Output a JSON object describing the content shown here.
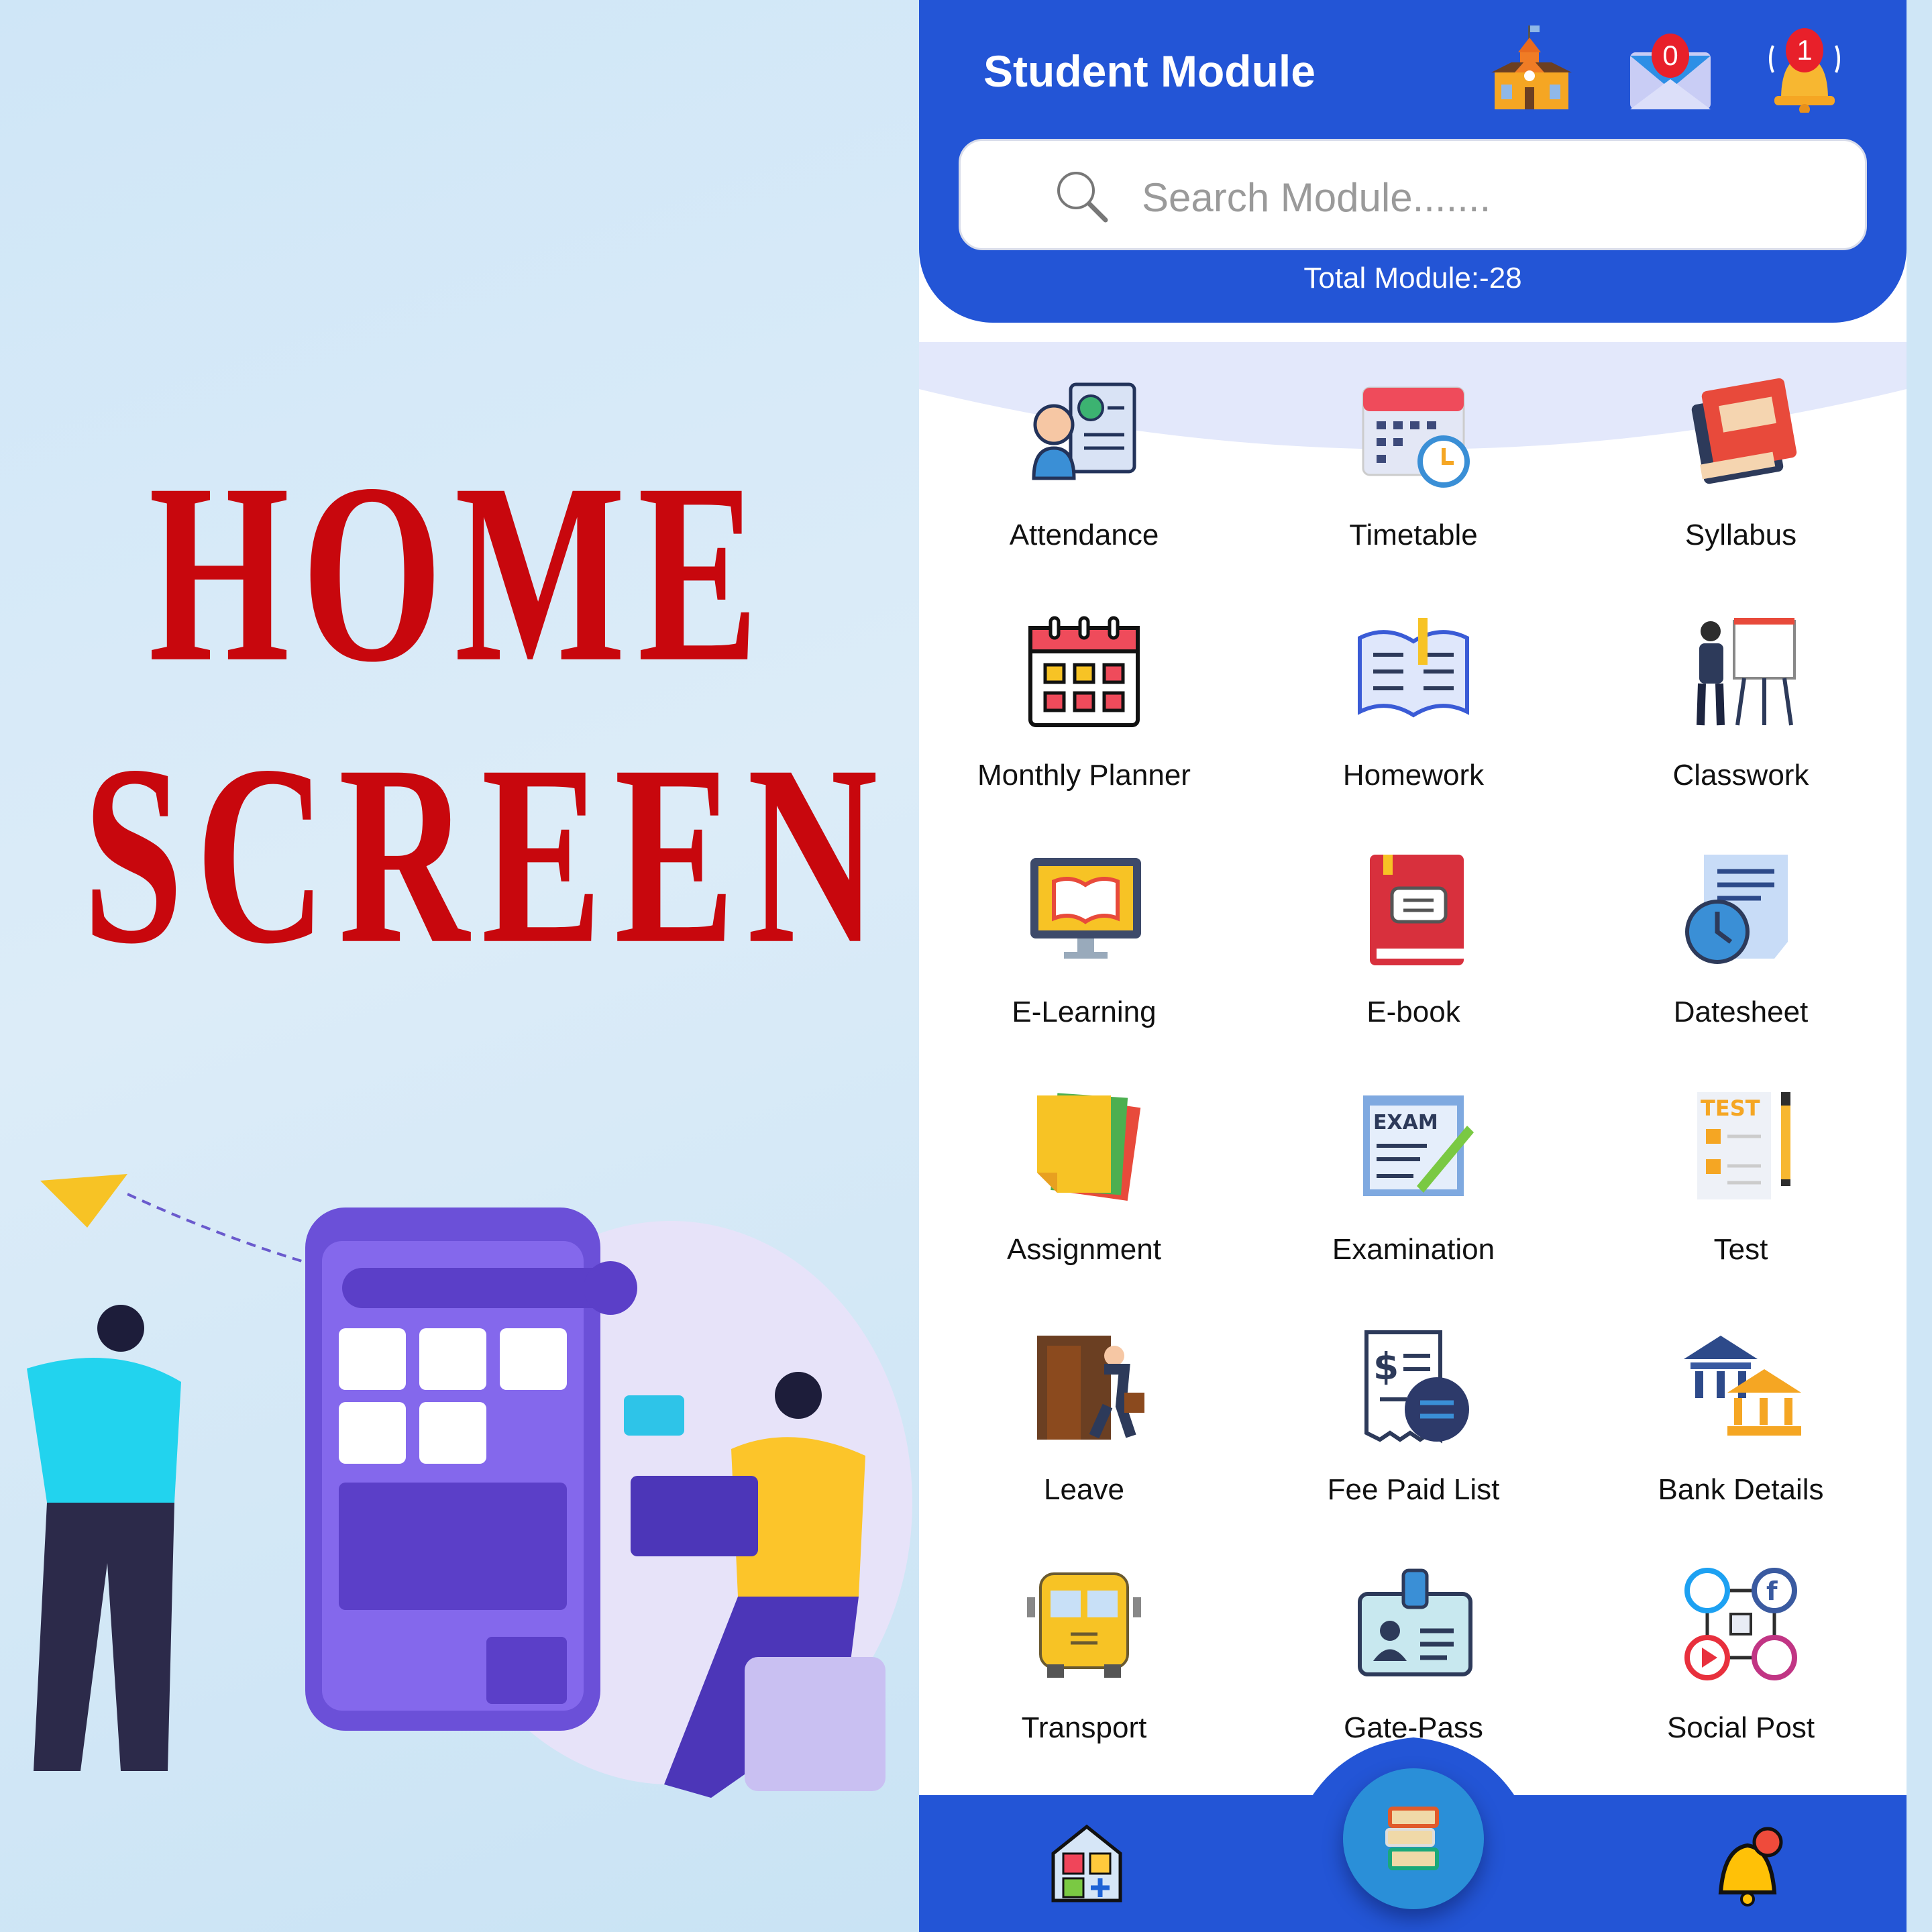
{
  "promo": {
    "line1": "HOME",
    "line2": "SCREEN"
  },
  "header": {
    "title": "Student Module",
    "icons": [
      "school-icon",
      "mail-icon",
      "bell-icon"
    ],
    "mail_count": "0",
    "notification_count": "1",
    "search_placeholder": "Search Module.......",
    "total_modules": "Total Module:-28"
  },
  "modules": [
    {
      "label": "Attendance",
      "icon": "attendance-icon"
    },
    {
      "label": "Timetable",
      "icon": "timetable-icon"
    },
    {
      "label": "Syllabus",
      "icon": "syllabus-icon"
    },
    {
      "label": "Monthly Planner",
      "icon": "planner-icon"
    },
    {
      "label": "Homework",
      "icon": "homework-icon"
    },
    {
      "label": "Classwork",
      "icon": "classwork-icon"
    },
    {
      "label": "E-Learning",
      "icon": "elearning-icon"
    },
    {
      "label": "E-book",
      "icon": "ebook-icon"
    },
    {
      "label": "Datesheet",
      "icon": "datesheet-icon"
    },
    {
      "label": "Assignment",
      "icon": "assignment-icon"
    },
    {
      "label": "Examination",
      "icon": "exam-icon"
    },
    {
      "label": "Test",
      "icon": "test-icon"
    },
    {
      "label": "Leave",
      "icon": "leave-icon"
    },
    {
      "label": "Fee Paid List",
      "icon": "fee-icon"
    },
    {
      "label": "Bank Details",
      "icon": "bank-icon"
    },
    {
      "label": "Transport",
      "icon": "bus-icon"
    },
    {
      "label": "Gate-Pass",
      "icon": "id-card-icon"
    },
    {
      "label": "Social Post",
      "icon": "social-icon"
    }
  ],
  "bottom_nav": [
    "home-dashboard-icon",
    "books-icon",
    "notification-bell-icon"
  ],
  "colors": {
    "primary": "#2355d6",
    "promo_text": "#c8070d",
    "fab": "#2a8fd8",
    "badge": "#e8202a"
  }
}
